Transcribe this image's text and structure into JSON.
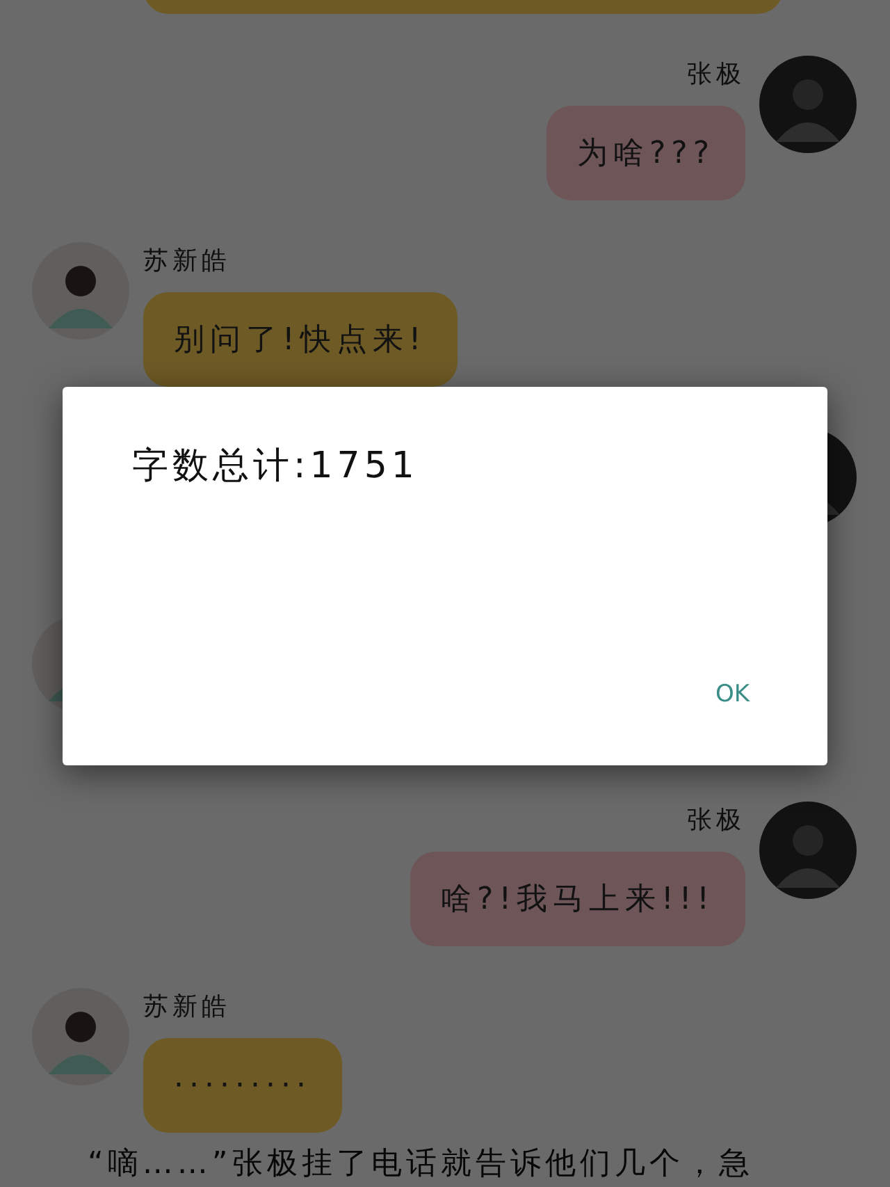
{
  "messages": [
    {
      "kind": "bubble_only",
      "outgoing": false
    },
    {
      "kind": "full",
      "outgoing": true,
      "name": "张极",
      "text": "为啥???"
    },
    {
      "kind": "full",
      "outgoing": false,
      "name": "苏新皓",
      "text": "别问了!快点来!"
    },
    {
      "kind": "avatar_only",
      "outgoing": true
    },
    {
      "kind": "avatar_only",
      "outgoing": false
    },
    {
      "kind": "full",
      "outgoing": true,
      "name": "张极",
      "text": "啥?!我马上来!!!"
    },
    {
      "kind": "full",
      "outgoing": false,
      "name": "苏新皓",
      "text": "·········"
    }
  ],
  "narration": "“嘀……”张极挂了电话就告诉他们几个，急",
  "dialog": {
    "message": "字数总计:1751",
    "button": "OK"
  }
}
